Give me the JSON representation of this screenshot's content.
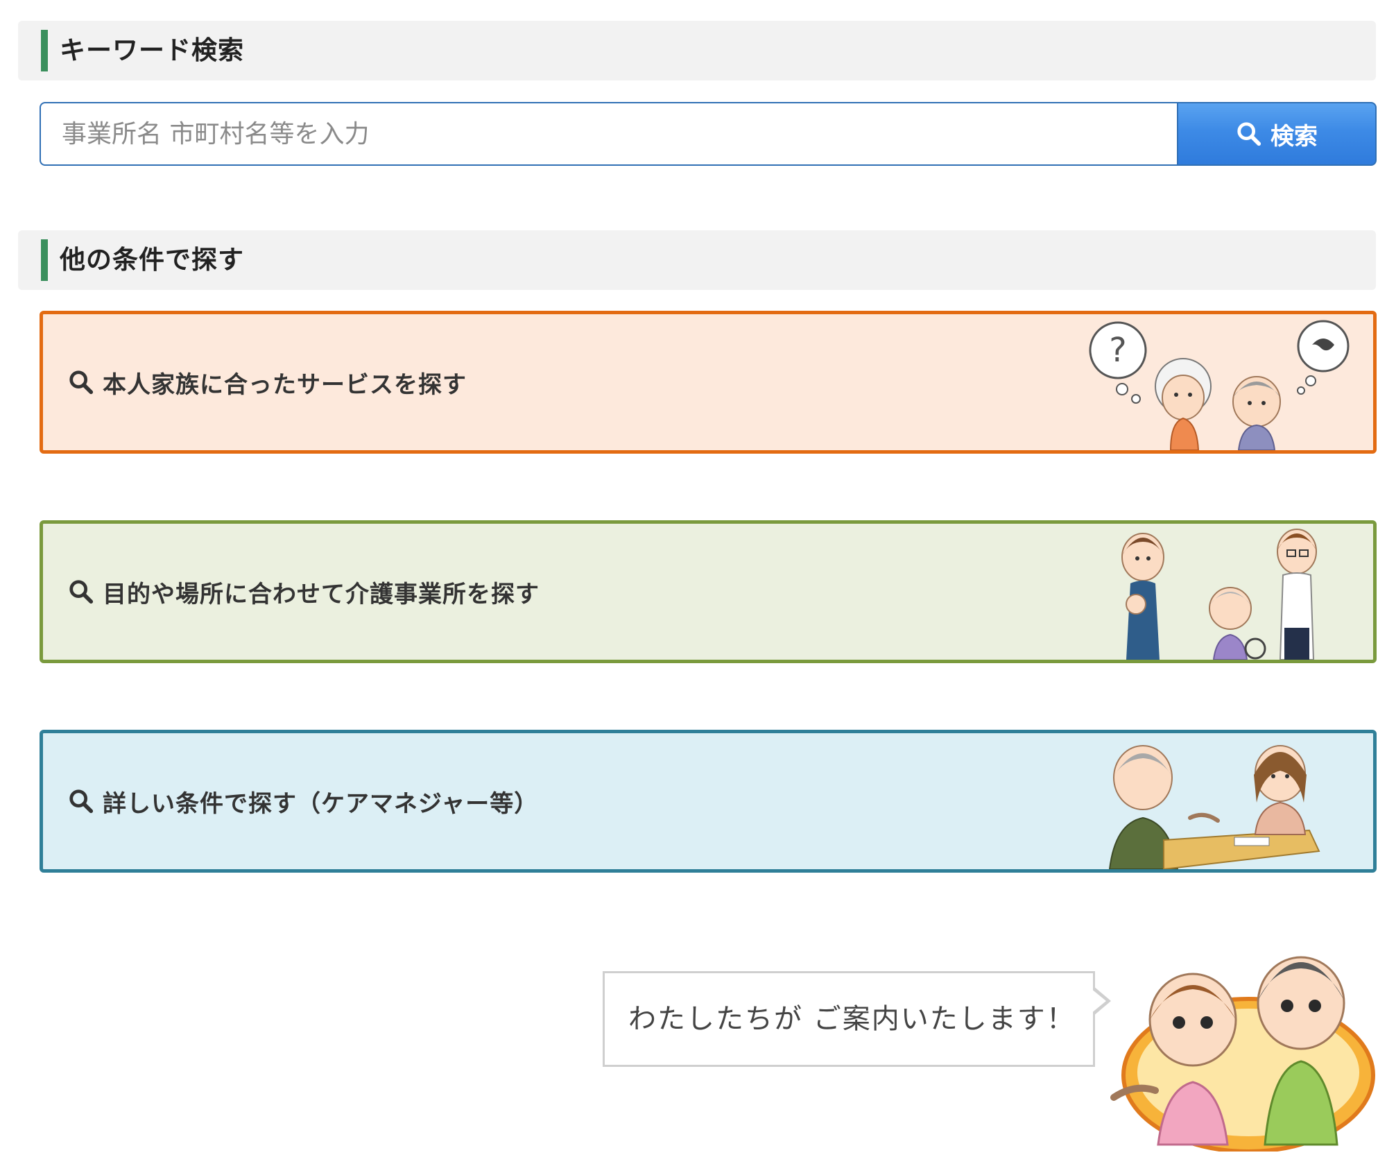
{
  "keyword_section": {
    "title": "キーワード検索",
    "search": {
      "placeholder": "事業所名 市町村名等を入力",
      "value": "",
      "button_label": "検索"
    }
  },
  "conditions_section": {
    "title": "他の条件で探す",
    "cards": [
      {
        "label": "本人家族に合ったサービスを探す",
        "border_color": "#e36b12",
        "bg_color": "#fde9dc"
      },
      {
        "label": "目的や場所に合わせて介護事業所を探す",
        "border_color": "#7a9a3d",
        "bg_color": "#ebf0df"
      },
      {
        "label": "詳しい条件で探す（ケアマネジャー等）",
        "border_color": "#2f7f98",
        "bg_color": "#dceff5"
      }
    ]
  },
  "guide": {
    "message": "わたしたちが ご案内いたします！"
  },
  "colors": {
    "accent_bar": "#3a8f5c",
    "search_border": "#2f6fb5",
    "search_button": "#3d8ae6"
  },
  "icons": [
    "search-icon",
    "magnifier-icon"
  ]
}
